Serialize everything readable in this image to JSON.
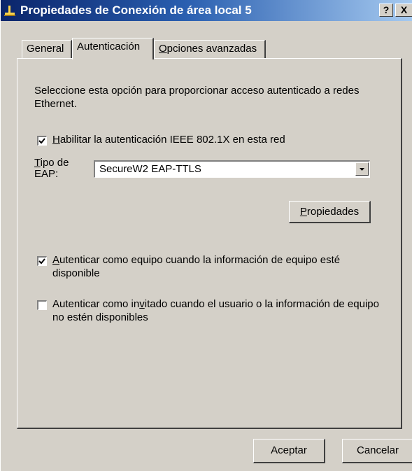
{
  "window": {
    "title": "Propiedades de Conexión de área local 5",
    "help_label": "?",
    "close_label": "X"
  },
  "tabs": [
    {
      "label": "General"
    },
    {
      "label": "Autenticación",
      "selected": true
    },
    {
      "label_rest": "pciones avanzadas",
      "mnemonic": "O"
    }
  ],
  "auth": {
    "description": "Seleccione esta opción para proporcionar acceso autenticado a redes Ethernet.",
    "enable_8021x": {
      "mnemonic": "H",
      "label_rest": "abilitar la autenticación IEEE 802.1X en esta red",
      "checked": true
    },
    "eap": {
      "label_mnemonic": "T",
      "label_rest": "ipo de EAP:",
      "value": "SecureW2 EAP-TTLS"
    },
    "properties_button": {
      "mnemonic": "P",
      "label_rest": "ropiedades"
    },
    "auth_computer": {
      "mnemonic": "A",
      "label_rest": "utenticar como equipo cuando la información de equipo esté disponible",
      "checked": true
    },
    "auth_guest": {
      "label_before": "Autenticar como in",
      "mnemonic": "v",
      "label_after": "itado cuando el usuario o la información de equipo no estén disponibles",
      "checked": false
    }
  },
  "footer": {
    "ok_label": "Aceptar",
    "cancel_label": "Cancelar"
  }
}
